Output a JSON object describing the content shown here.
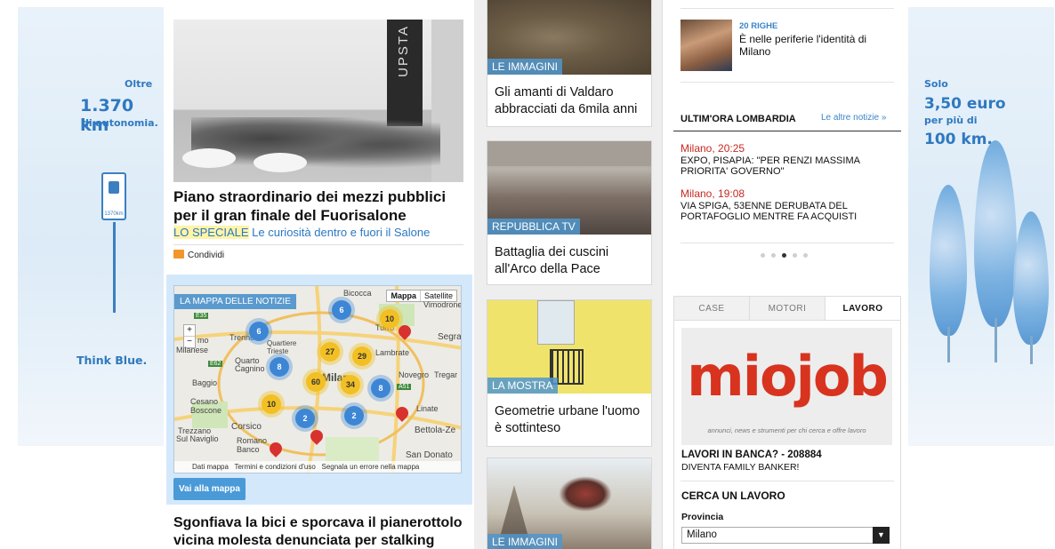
{
  "ad_left": {
    "line1": "Oltre",
    "km": "1.370 km",
    "line3": "di autonomia.",
    "badge": "1370km",
    "brand": "Think Blue."
  },
  "ad_right": {
    "line1": "Solo",
    "price": "3,50 euro",
    "line3": "per più di",
    "km": "100 km."
  },
  "hero": {
    "title": "Piano straordinario dei mezzi pubblici per il gran finale del Fuorisalone",
    "speciale_tag": "LO SPECIALE",
    "speciale_text": "Le curiosità dentro e fuori il Salone",
    "share": "Condividi",
    "banner_text": "UPSTA"
  },
  "map": {
    "tag": "LA MAPPA DELLE NOTIZIE",
    "toggle_map": "Mappa",
    "toggle_sat": "Satellite",
    "zoom_in": "+",
    "zoom_out": "−",
    "places": [
      "Bicocca",
      "Vimodrone",
      "Segra",
      "Milanese",
      "Trenno",
      "Quartiere",
      "Trieste",
      "Lambrate",
      "Quarto",
      "Cagnino",
      "Baggio",
      "Novegro",
      "Tregar",
      "Cesano",
      "Boscone",
      "Linate",
      "Trezzano",
      "Sul Naviglio",
      "Corsico",
      "Romano",
      "Banco",
      "Bettola-Ze",
      "San Donato",
      "Milan",
      "E35",
      "E62",
      "A51",
      "Turro",
      "mo"
    ],
    "clusters": [
      "6",
      "10",
      "6",
      "27",
      "29",
      "8",
      "60",
      "34",
      "8",
      "10",
      "2",
      "2"
    ],
    "footer_data": "Dati mappa",
    "footer_terms": "Termini e condizioni d'uso",
    "footer_report": "Segnala un errore nella mappa",
    "button": "Vai alla mappa"
  },
  "bottom_story": {
    "title": "Sgonfiava la bici e sporcava il pianerottolo vicina molesta denunciata per stalking"
  },
  "mid_column": [
    {
      "tag": "LE IMMAGINI",
      "title": "Gli amanti di Valdaro abbracciati da 6mila anni"
    },
    {
      "tag": "REPUBBLICA TV",
      "title": "Battaglia dei cuscini all'Arco della Pace"
    },
    {
      "tag": "LA MOSTRA",
      "title": "Geometrie urbane l'uomo è sottinteso"
    },
    {
      "tag": "LE IMMAGINI",
      "title": ""
    }
  ],
  "venti_righe": {
    "tag": "20 RIGHE",
    "title": "È nelle periferie l'identità di Milano"
  },
  "ultimora": {
    "heading": "ULTIM'ORA LOMBARDIA",
    "more": "Le altre notizie  »",
    "items": [
      {
        "time": "Milano, 20:25",
        "text": "EXPO, PISAPIA: \"PER RENZI MASSIMA PRIORITA' GOVERNO\""
      },
      {
        "time": "Milano, 19:08",
        "text": "VIA SPIGA, 53ENNE DERUBATA DEL PORTAFOGLIO MENTRE FA ACQUISTI"
      }
    ],
    "active_dot": 3
  },
  "jobs": {
    "tabs": [
      "CASE",
      "MOTORI",
      "LAVORO"
    ],
    "logo": "miojob",
    "logo_sub": "annunci, news e strumenti per chi cerca e offre lavoro",
    "headline": "LAVORI IN BANCA? - 208884",
    "subline": "DIVENTA FAMILY BANKER!",
    "search_title": "CERCA UN LAVORO",
    "province_label": "Provincia",
    "province_value": "Milano"
  },
  "colors": {
    "accent_blue": "#3a85c7",
    "time_red": "#c8281f",
    "miojob_red": "#d8331f",
    "tag_blue": "#5096cd",
    "highlight": "#fff4a8"
  }
}
